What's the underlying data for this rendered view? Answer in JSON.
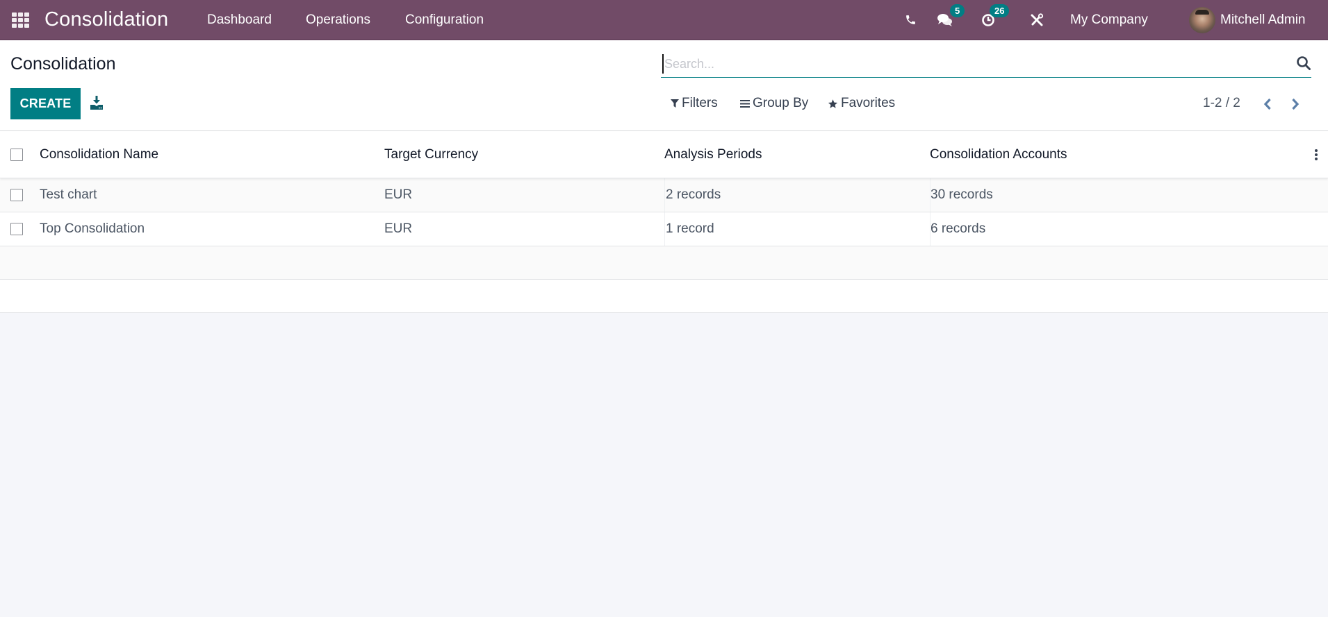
{
  "navbar": {
    "app_name": "Consolidation",
    "menu": [
      {
        "label": "Dashboard"
      },
      {
        "label": "Operations"
      },
      {
        "label": "Configuration"
      }
    ],
    "messages_badge": "5",
    "activities_badge": "26",
    "company": "My Company",
    "user": "Mitchell Admin",
    "colors": {
      "bar": "#714b67",
      "badge": "#017e84"
    }
  },
  "control_panel": {
    "title": "Consolidation",
    "create_label": "CREATE",
    "search_placeholder": "Search...",
    "search_value": "",
    "filters_label": "Filters",
    "group_by_label": "Group By",
    "favorites_label": "Favorites",
    "pager": "1-2 / 2",
    "accent": "#017e84"
  },
  "table": {
    "columns": [
      {
        "label": "Consolidation Name"
      },
      {
        "label": "Target Currency"
      },
      {
        "label": "Analysis Periods"
      },
      {
        "label": "Consolidation Accounts"
      }
    ],
    "rows": [
      {
        "name": "Test chart",
        "currency": "EUR",
        "periods": "2 records",
        "accounts": "30 records"
      },
      {
        "name": "Top Consolidation",
        "currency": "EUR",
        "periods": "1 record",
        "accounts": "6 records"
      }
    ]
  }
}
